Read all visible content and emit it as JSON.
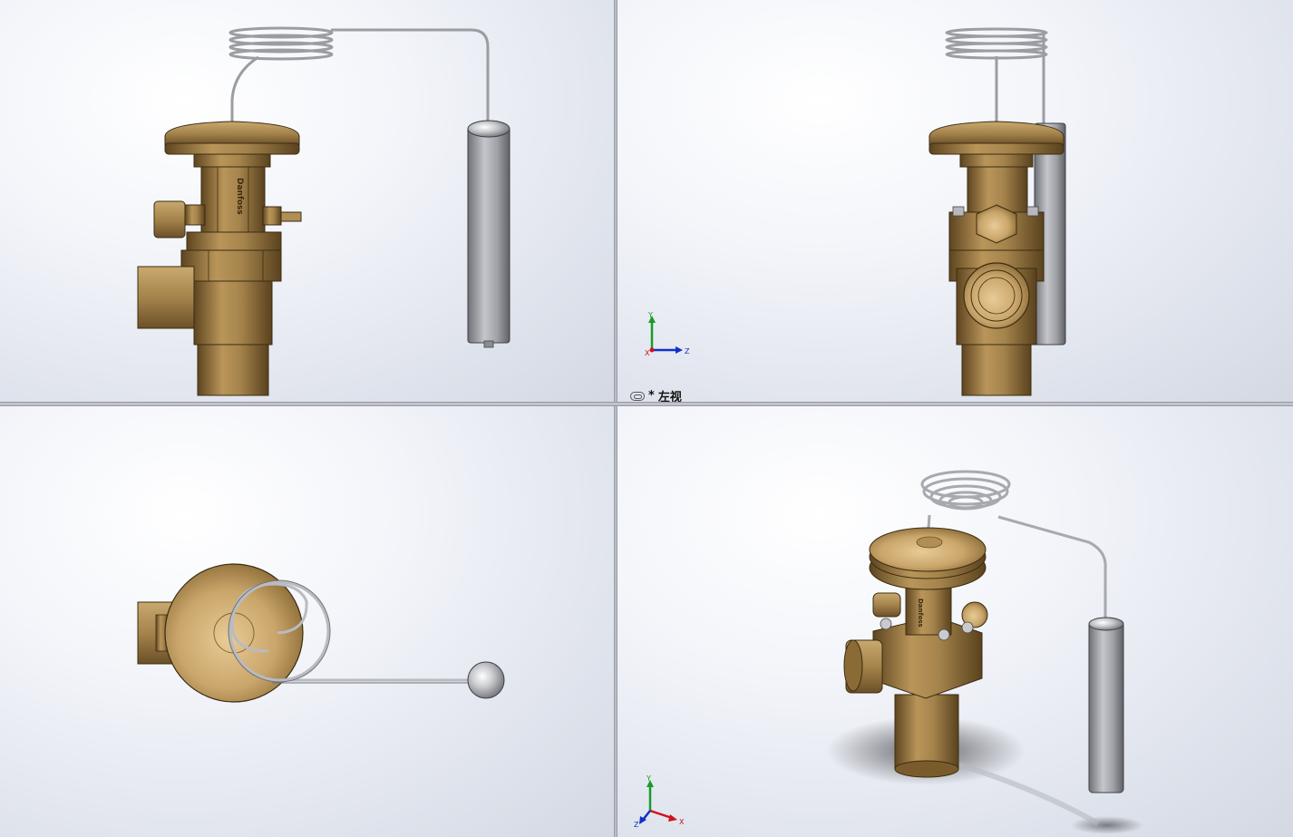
{
  "viewports": {
    "top_left": {
      "name": "front-view"
    },
    "top_right": {
      "name": "left-view",
      "label_prefix": "*",
      "label": "左视"
    },
    "bottom_left": {
      "name": "top-view"
    },
    "bottom_right": {
      "name": "isometric-view"
    }
  },
  "triad": {
    "x": "X",
    "y": "Y",
    "z": "Z"
  },
  "brand": "Danfoss",
  "colors": {
    "brass": "#a8874e",
    "brass_dark": "#6e5428",
    "brass_light": "#d2b27a",
    "steel": "#a6a8ad",
    "axis_x": "#d0101a",
    "axis_y": "#1a9a2a",
    "axis_z": "#1030c8"
  }
}
